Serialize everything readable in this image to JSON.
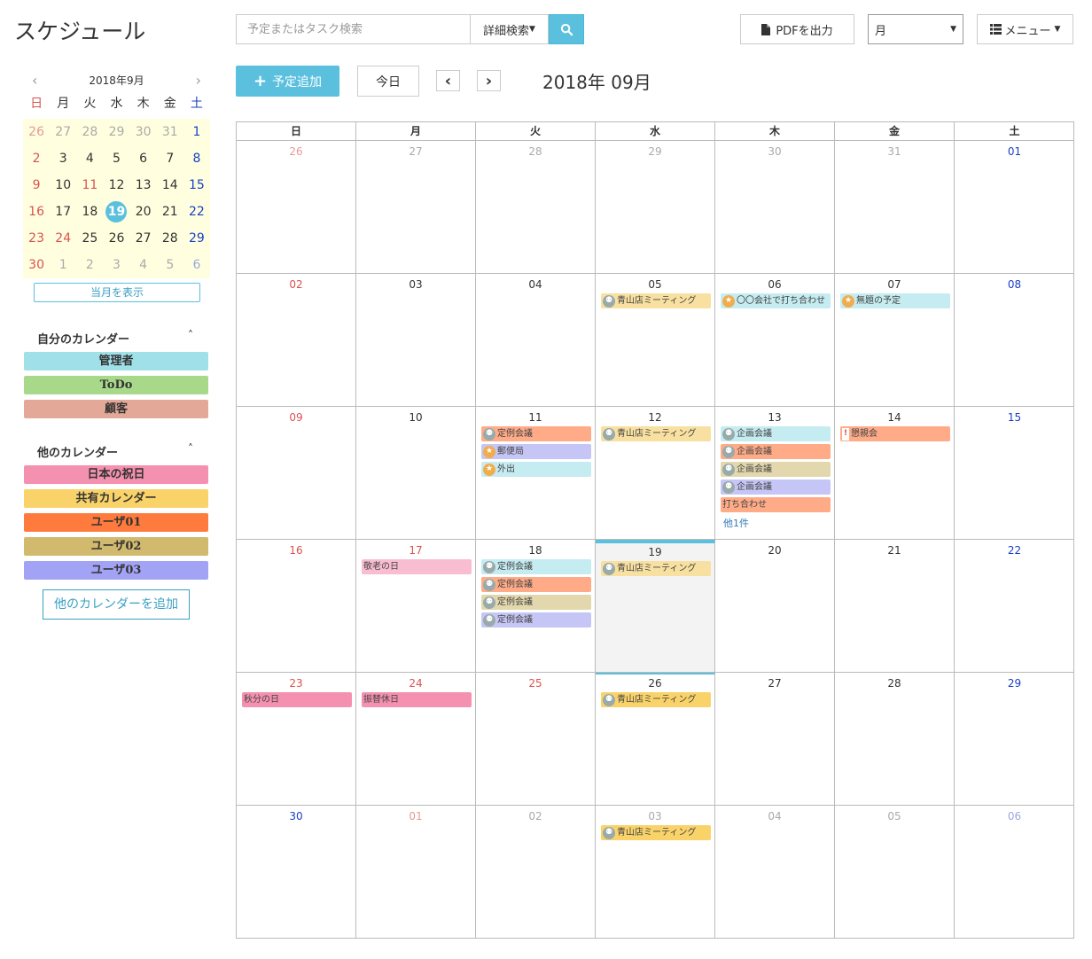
{
  "header": {
    "title": "スケジュール",
    "search_placeholder": "予定またはタスク検索",
    "advanced_search": "詳細検索",
    "pdf_label": "PDFを出力",
    "view_value": "月",
    "menu_label": "メニュー"
  },
  "mini_calendar": {
    "month_label": "2018年9月",
    "weekdays": [
      "日",
      "月",
      "火",
      "水",
      "木",
      "金",
      "土"
    ],
    "days": [
      "26",
      "27",
      "28",
      "29",
      "30",
      "31",
      "1",
      "2",
      "3",
      "4",
      "5",
      "6",
      "7",
      "8",
      "9",
      "10",
      "11",
      "12",
      "13",
      "14",
      "15",
      "16",
      "17",
      "18",
      "19",
      "20",
      "21",
      "22",
      "23",
      "24",
      "25",
      "26",
      "27",
      "28",
      "29",
      "30",
      "1",
      "2",
      "3",
      "4",
      "5",
      "6"
    ],
    "show_current_label": "当月を表示"
  },
  "my_calendars": {
    "title": "自分のカレンダー",
    "items": [
      {
        "label": "管理者",
        "color": "#a0e0e8"
      },
      {
        "label": "ToDo",
        "color": "#a8d98a"
      },
      {
        "label": "顧客",
        "color": "#e3a898"
      }
    ]
  },
  "other_calendars": {
    "title": "他のカレンダー",
    "items": [
      {
        "label": "日本の祝日",
        "color": "#f591b0"
      },
      {
        "label": "共有カレンダー",
        "color": "#f9d36a"
      },
      {
        "label": "ユーザ01",
        "color": "#ff7a3d"
      },
      {
        "label": "ユーザ02",
        "color": "#d1b96e"
      },
      {
        "label": "ユーザ03",
        "color": "#a3a3f5"
      }
    ],
    "add_label": "他のカレンダーを追加"
  },
  "toolbar": {
    "add_label": "予定追加",
    "today_label": "今日",
    "prev": "‹",
    "next": "›",
    "current_month": "2018年 09月"
  },
  "calendar": {
    "weekdays": [
      "日",
      "月",
      "火",
      "水",
      "木",
      "金",
      "土"
    ],
    "weeks": [
      [
        {
          "d": "26",
          "fade": true
        },
        {
          "d": "27",
          "fade": true
        },
        {
          "d": "28",
          "fade": true
        },
        {
          "d": "29",
          "fade": true
        },
        {
          "d": "30",
          "fade": true
        },
        {
          "d": "31",
          "fade": true
        },
        {
          "d": "01"
        }
      ],
      [
        {
          "d": "02"
        },
        {
          "d": "03"
        },
        {
          "d": "04"
        },
        {
          "d": "05",
          "events": [
            {
              "t": "青山店ミーティング",
              "c": "#f8e0a0",
              "i": "meet"
            }
          ]
        },
        {
          "d": "06",
          "events": [
            {
              "t": "〇〇会社で打ち合わせ",
              "c": "#c5ecf0",
              "i": "walk"
            }
          ]
        },
        {
          "d": "07",
          "events": [
            {
              "t": "無題の予定",
              "c": "#c5ecf0",
              "i": "walk"
            }
          ]
        },
        {
          "d": "08"
        }
      ],
      [
        {
          "d": "09"
        },
        {
          "d": "10"
        },
        {
          "d": "11",
          "events": [
            {
              "t": "定例会議",
              "c": "#ffab88",
              "i": "meet"
            },
            {
              "t": "郵便局",
              "c": "#c6c6f6",
              "i": "walk"
            },
            {
              "t": "外出",
              "c": "#c5ecf0",
              "i": "walk"
            }
          ]
        },
        {
          "d": "12",
          "events": [
            {
              "t": "青山店ミーティング",
              "c": "#f8e0a0",
              "i": "meet"
            }
          ]
        },
        {
          "d": "13",
          "events": [
            {
              "t": "企画会議",
              "c": "#c5ecf0",
              "i": "meet"
            },
            {
              "t": "企画会議",
              "c": "#ffab88",
              "i": "meet"
            },
            {
              "t": "企画会議",
              "c": "#e3d8ad",
              "i": "meet"
            },
            {
              "t": "企画会議",
              "c": "#c6c6f6",
              "i": "meet"
            },
            {
              "t": "打ち合わせ",
              "c": "#ffab88",
              "i": ""
            }
          ],
          "more": "他1件"
        },
        {
          "d": "14",
          "events": [
            {
              "t": "懇親会",
              "c": "#ffab88",
              "i": "alert"
            }
          ]
        },
        {
          "d": "15"
        }
      ],
      [
        {
          "d": "16"
        },
        {
          "d": "17",
          "holiday": true,
          "events": [
            {
              "t": "敬老の日",
              "c": "#f8bdd0",
              "i": ""
            }
          ]
        },
        {
          "d": "18",
          "events": [
            {
              "t": "定例会議",
              "c": "#c5ecf0",
              "i": "meet"
            },
            {
              "t": "定例会議",
              "c": "#ffab88",
              "i": "meet"
            },
            {
              "t": "定例会議",
              "c": "#e3d8ad",
              "i": "meet"
            },
            {
              "t": "定例会議",
              "c": "#c6c6f6",
              "i": "meet"
            }
          ]
        },
        {
          "d": "19",
          "today": true,
          "events": [
            {
              "t": "青山店ミーティング",
              "c": "#f8e0a0",
              "i": "meet"
            }
          ]
        },
        {
          "d": "20"
        },
        {
          "d": "21"
        },
        {
          "d": "22"
        }
      ],
      [
        {
          "d": "23",
          "events": [
            {
              "t": "秋分の日",
              "c": "#f591b0",
              "i": ""
            }
          ]
        },
        {
          "d": "24",
          "holiday": true,
          "events": [
            {
              "t": "振替休日",
              "c": "#f591b0",
              "i": ""
            }
          ]
        },
        {
          "d": "25",
          "holiday": true
        },
        {
          "d": "26",
          "events": [
            {
              "t": "青山店ミーティング",
              "c": "#f9d36a",
              "i": "meet"
            }
          ]
        },
        {
          "d": "27"
        },
        {
          "d": "28"
        },
        {
          "d": "29"
        }
      ],
      [
        {
          "d": "30",
          "sat_color": true
        },
        {
          "d": "01",
          "fade": true,
          "holiday": true
        },
        {
          "d": "02",
          "fade": true
        },
        {
          "d": "03",
          "fade": true,
          "events": [
            {
              "t": "青山店ミーティング",
              "c": "#f9d36a",
              "i": "meet"
            }
          ]
        },
        {
          "d": "04",
          "fade": true
        },
        {
          "d": "05",
          "fade": true
        },
        {
          "d": "06",
          "fade": true
        }
      ]
    ]
  }
}
